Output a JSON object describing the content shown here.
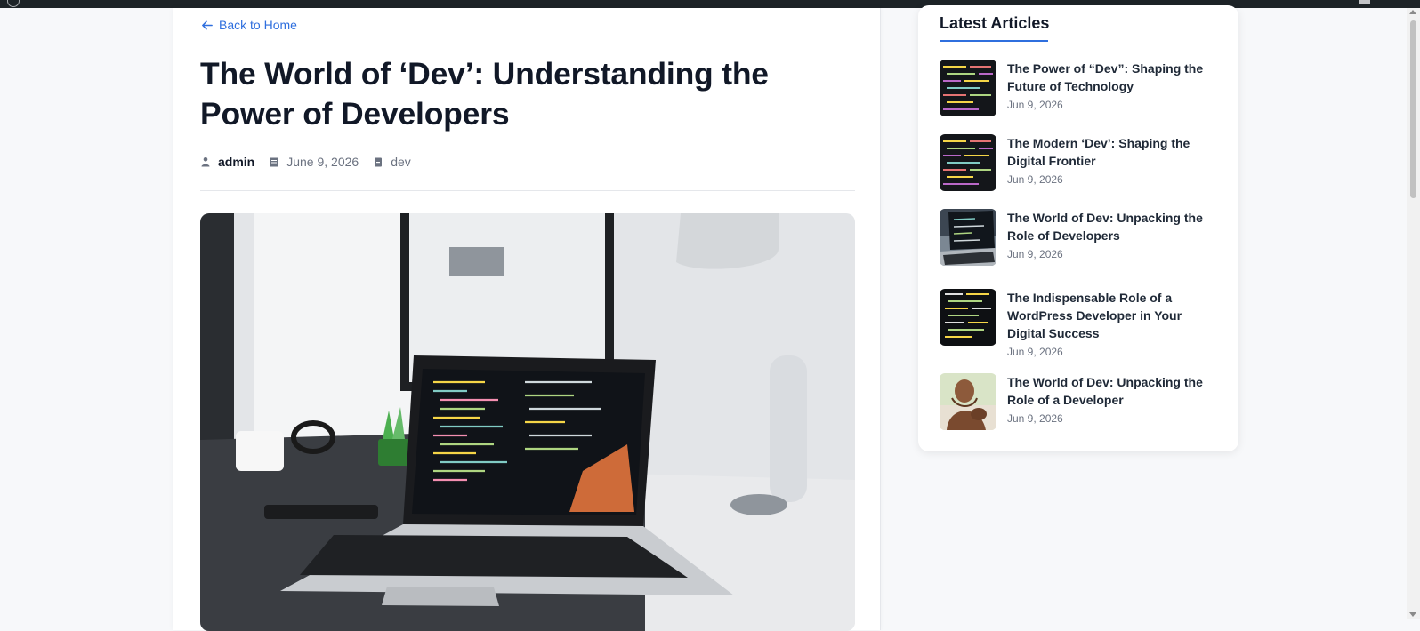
{
  "article": {
    "back_label": "Back to Home",
    "title": "The World of ‘Dev’: Understanding the Power of Developers",
    "author": "admin",
    "date": "June 9, 2026",
    "category": "dev"
  },
  "sidebar": {
    "title": "Latest Articles",
    "items": [
      {
        "title": "The Power of “Dev”: Shaping the Future of Technology",
        "date": "Jun 9, 2026"
      },
      {
        "title": "The Modern ‘Dev’: Shaping the Digital Frontier",
        "date": "Jun 9, 2026"
      },
      {
        "title": "The World of Dev: Unpacking the Role of Developers",
        "date": "Jun 9, 2026"
      },
      {
        "title": "The Indispensable Role of a WordPress Developer in Your Digital Success",
        "date": "Jun 9, 2026"
      },
      {
        "title": "The World of Dev: Unpacking the Role of a Developer",
        "date": "Jun 9, 2026"
      }
    ]
  },
  "colors": {
    "accent": "#2f6fde",
    "heading": "#111827",
    "muted": "#6b7280",
    "admin_bar": "#1d2327"
  },
  "icons": {
    "back": "arrow-left-icon",
    "author": "user-icon",
    "date": "calendar-icon",
    "category": "folder-icon"
  }
}
